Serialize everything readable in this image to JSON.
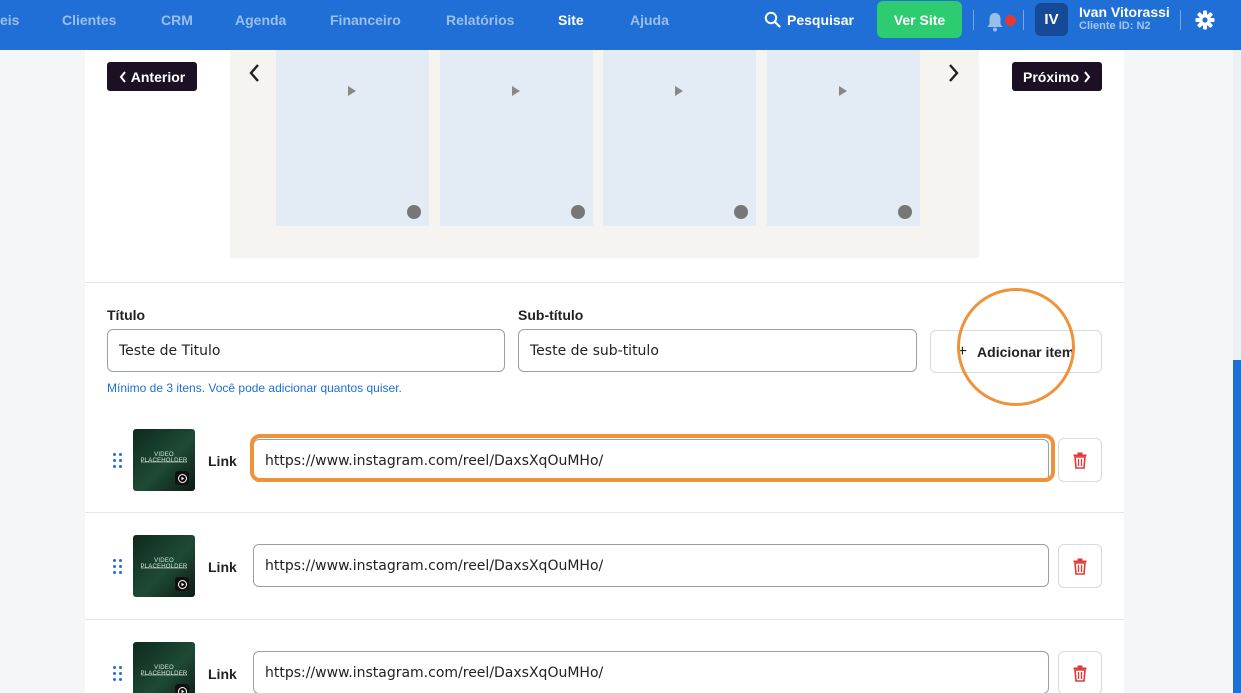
{
  "nav": {
    "items": [
      {
        "label": "eis",
        "active": false
      },
      {
        "label": "Clientes",
        "active": false
      },
      {
        "label": "CRM",
        "active": false
      },
      {
        "label": "Agenda",
        "active": false
      },
      {
        "label": "Financeiro",
        "active": false
      },
      {
        "label": "Relatórios",
        "active": false
      },
      {
        "label": "Site",
        "active": true
      },
      {
        "label": "Ajuda",
        "active": false
      }
    ],
    "search_label": "Pesquisar",
    "ver_site_label": "Ver Site",
    "avatar_initials": "IV",
    "user_name": "Ivan Vitorassi",
    "client_id": "Cliente ID: N2",
    "colors": {
      "bar": "#1f6fd6",
      "ver_site": "#2ecc71",
      "notification_dot": "#e53935"
    }
  },
  "carousel": {
    "prev_label": "Anterior",
    "next_label": "Próximo",
    "thumbnail_count": 4
  },
  "form": {
    "title_label": "Título",
    "title_value": "Teste de Titulo",
    "subtitle_label": "Sub-título",
    "subtitle_value": "Teste de sub-titulo",
    "add_item_label": "Adicionar item",
    "hint": "Mínimo de 3 itens. Você pode adicionar quantos quiser."
  },
  "items": [
    {
      "link_label": "Link",
      "url": "https://www.instagram.com/reel/DaxsXqOuMHo/",
      "thumb_text": "VIDEO PLACEHOLDER"
    },
    {
      "link_label": "Link",
      "url": "https://www.instagram.com/reel/DaxsXqOuMHo/",
      "thumb_text": "VIDEO PLACEHOLDER"
    },
    {
      "link_label": "Link",
      "url": "https://www.instagram.com/reel/DaxsXqOuMHo/",
      "thumb_text": "VIDEO PLACEHOLDER"
    }
  ],
  "annotation_color": "#f0923a"
}
